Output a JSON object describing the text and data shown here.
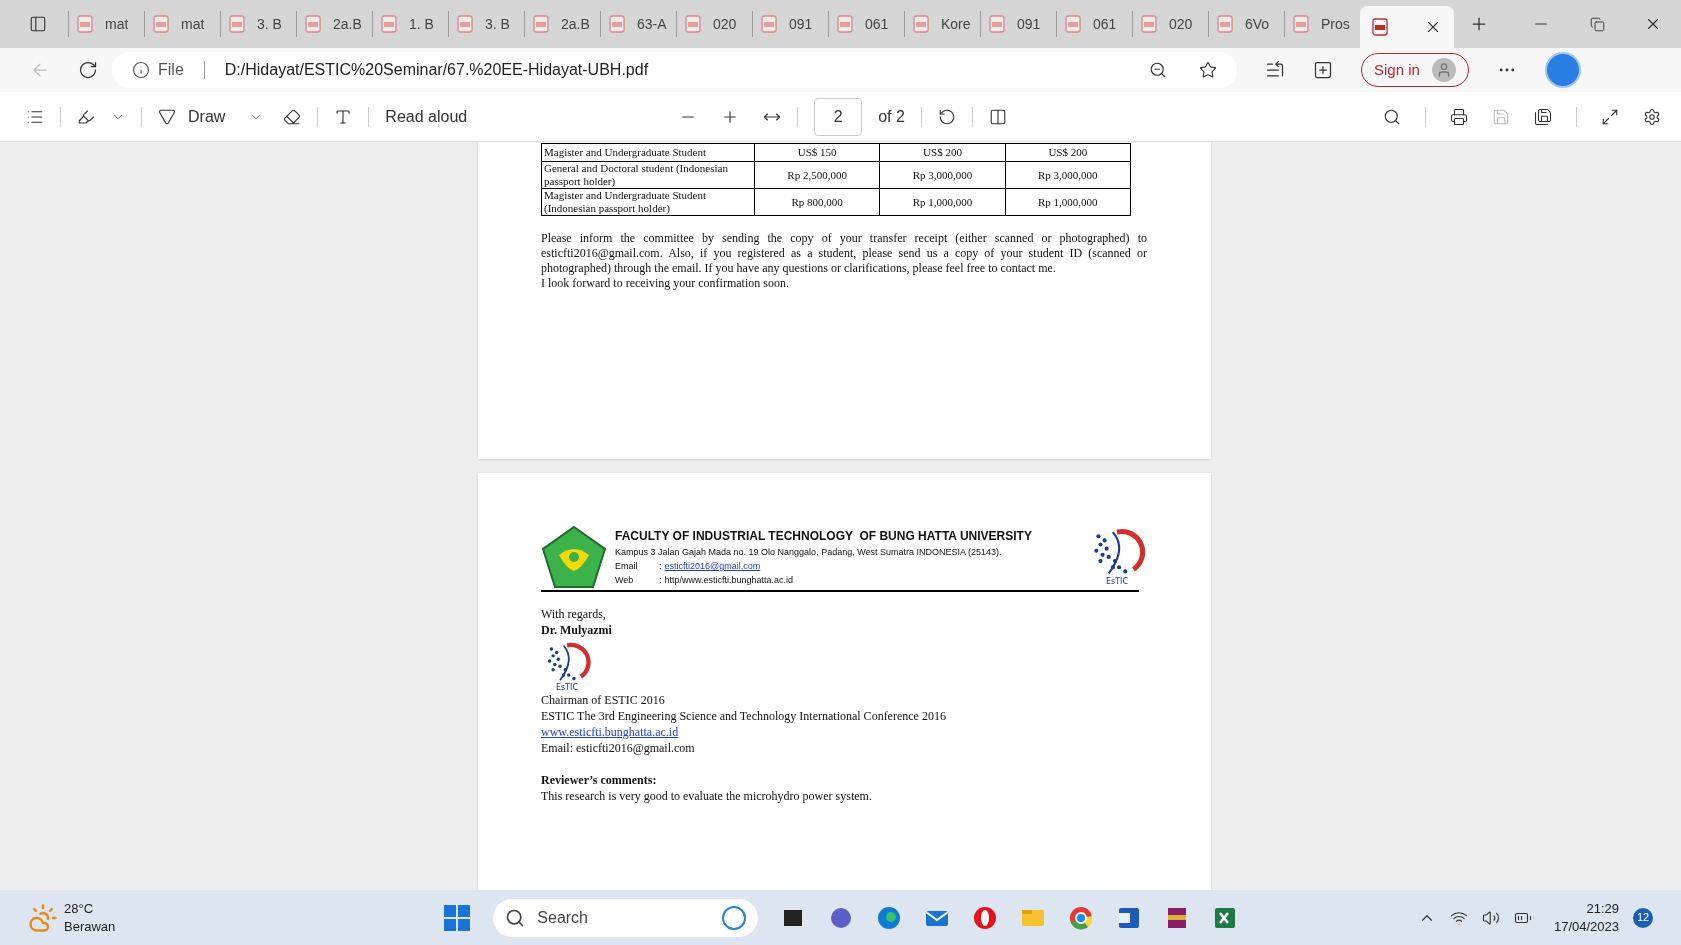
{
  "browser": {
    "tabs": [
      {
        "label": "mat",
        "selected": false
      },
      {
        "label": "mat",
        "selected": false
      },
      {
        "label": "3. B",
        "selected": false
      },
      {
        "label": "2a.B",
        "selected": false
      },
      {
        "label": "1. B",
        "selected": false
      },
      {
        "label": "3. B",
        "selected": false
      },
      {
        "label": "2a.B",
        "selected": false
      },
      {
        "label": "63-A",
        "selected": false
      },
      {
        "label": "020",
        "selected": false
      },
      {
        "label": "091",
        "selected": false
      },
      {
        "label": "061",
        "selected": false
      },
      {
        "label": "Kore",
        "selected": false
      },
      {
        "label": "091",
        "selected": false
      },
      {
        "label": "061",
        "selected": false
      },
      {
        "label": "020",
        "selected": false
      },
      {
        "label": "6Vo",
        "selected": false
      },
      {
        "label": "Pros",
        "selected": false
      },
      {
        "selected": true
      }
    ],
    "address": {
      "scheme": "File",
      "url": "D:/Hidayat/ESTIC%20Seminar/67.%20EE-Hidayat-UBH.pdf"
    },
    "sign_in": "Sign in"
  },
  "pdf_toolbar": {
    "draw": "Draw",
    "read_aloud": "Read aloud",
    "page": "2",
    "page_count": "of 2"
  },
  "document": {
    "table": {
      "rows": [
        {
          "category": "Magister and Undergraduate Student",
          "cells": [
            "US$ 150",
            "US$ 200",
            "US$ 200"
          ]
        },
        {
          "category": "General and Doctoral student (Indonesian passport holder)",
          "cells": [
            "Rp 2,500,000",
            "Rp 3,000,000",
            "Rp 3,000,000"
          ]
        },
        {
          "category": "Magister and Undergraduate Student (Indonesian passport holder)",
          "cells": [
            "Rp 800,000",
            "Rp 1,000,000",
            "Rp 1,000,000"
          ]
        }
      ]
    },
    "paragraphs": [
      "Please inform the committee by sending the copy of your transfer receipt (either scanned or photographed) to esticfti2016@gmail.com. Also, if you registered as a student, please send us a copy of your student ID (scanned or photographed) through the email. If you have any questions or clarifications, please feel free to contact me.",
      "I look forward to receiving your confirmation soon."
    ],
    "letterhead": {
      "title": "FACULTY OF INDUSTRIAL TECHNOLOGY  OF BUNG HATTA UNIVERSITY",
      "address": "Kampus 3 Jalan Gajah Mada no. 19 Olo Nanggalo, Padang, West Sumatra INDONESIA (25143).",
      "contacts": [
        {
          "label": "Email",
          "colon": ":",
          "value": "esticfti2016@gmail.com",
          "kind": "link"
        },
        {
          "label": "Web",
          "colon": ":",
          "value": "http/www.esticfti.bunghatta.ac.id",
          "kind": "text"
        }
      ],
      "logo_caption": "EsTIC"
    },
    "signature": {
      "closing": "With regards,",
      "name": "Dr. Mulyazmi",
      "logo_caption": "EsTIC",
      "lines": [
        {
          "text": "Chairman of ESTIC 2016",
          "kind": "text"
        },
        {
          "text": "ESTIC The 3rd Engineering Science and Technology International Conference 2016",
          "kind": "text"
        },
        {
          "text": "www.esticfti.bunghatta.ac.id",
          "kind": "link"
        },
        {
          "text": "Email: esticfti2016@gmail.com",
          "kind": "text"
        }
      ]
    },
    "reviewer": {
      "heading": "Reviewer’s comments:",
      "comment": "This research is very good to evaluate the microhydro power system."
    }
  },
  "taskbar": {
    "weather": {
      "temperature": "28°C",
      "condition": "Berawan"
    },
    "search": "Search",
    "apps": [
      {
        "kind": "files"
      },
      {
        "kind": "chat"
      },
      {
        "kind": "edge"
      },
      {
        "kind": "mail"
      },
      {
        "kind": "opera"
      },
      {
        "kind": "folder"
      },
      {
        "kind": "chrome"
      },
      {
        "kind": "word"
      },
      {
        "kind": "archive"
      },
      {
        "kind": "excel"
      }
    ],
    "time": "21:29",
    "date": "17/04/2023",
    "notifications": "12"
  }
}
